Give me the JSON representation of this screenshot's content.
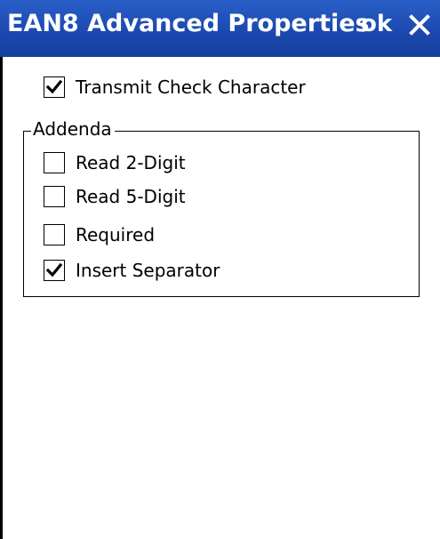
{
  "dialog": {
    "title": "EAN8 Advanced Properties",
    "ok_label": "ok",
    "close_icon": "close-icon"
  },
  "options": {
    "transmit_check": {
      "label": "Transmit Check Character",
      "checked": true
    }
  },
  "addenda": {
    "legend": "Addenda",
    "items": [
      {
        "label": "Read 2-Digit",
        "checked": false
      },
      {
        "label": "Read 5-Digit",
        "checked": false
      },
      {
        "label": "Required",
        "checked": false
      },
      {
        "label": "Insert Separator",
        "checked": true
      }
    ]
  },
  "colors": {
    "titlebar": "#1b49b0",
    "titlebar_text": "#ffffff",
    "background": "#ffffff"
  }
}
